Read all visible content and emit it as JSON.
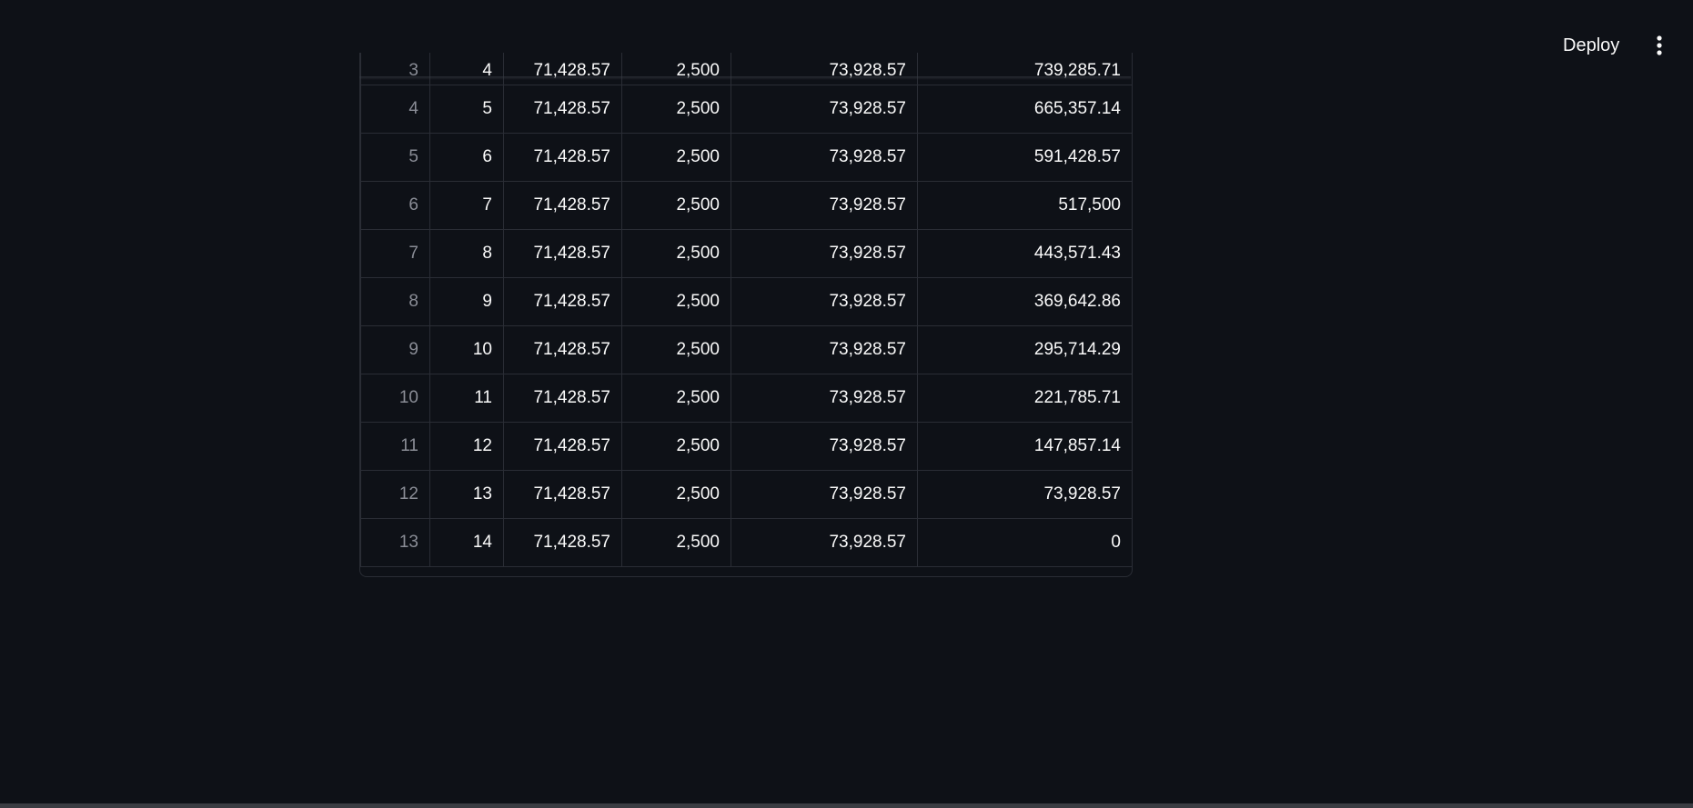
{
  "header": {
    "deploy_label": "Deploy",
    "menu_icon": "vertical-dots-icon"
  },
  "table": {
    "columns": [
      "",
      "",
      "",
      "",
      "",
      ""
    ],
    "partial_row": {
      "index": "3",
      "cells": [
        "4",
        "71,428.57",
        "2,500",
        "73,928.57",
        "739,285.71"
      ]
    },
    "rows": [
      {
        "index": "4",
        "cells": [
          "5",
          "71,428.57",
          "2,500",
          "73,928.57",
          "665,357.14"
        ]
      },
      {
        "index": "5",
        "cells": [
          "6",
          "71,428.57",
          "2,500",
          "73,928.57",
          "591,428.57"
        ]
      },
      {
        "index": "6",
        "cells": [
          "7",
          "71,428.57",
          "2,500",
          "73,928.57",
          "517,500"
        ]
      },
      {
        "index": "7",
        "cells": [
          "8",
          "71,428.57",
          "2,500",
          "73,928.57",
          "443,571.43"
        ]
      },
      {
        "index": "8",
        "cells": [
          "9",
          "71,428.57",
          "2,500",
          "73,928.57",
          "369,642.86"
        ]
      },
      {
        "index": "9",
        "cells": [
          "10",
          "71,428.57",
          "2,500",
          "73,928.57",
          "295,714.29"
        ]
      },
      {
        "index": "10",
        "cells": [
          "11",
          "71,428.57",
          "2,500",
          "73,928.57",
          "221,785.71"
        ]
      },
      {
        "index": "11",
        "cells": [
          "12",
          "71,428.57",
          "2,500",
          "73,928.57",
          "147,857.14"
        ]
      },
      {
        "index": "12",
        "cells": [
          "13",
          "71,428.57",
          "2,500",
          "73,928.57",
          "73,928.57"
        ]
      },
      {
        "index": "13",
        "cells": [
          "14",
          "71,428.57",
          "2,500",
          "73,928.57",
          "0"
        ]
      }
    ]
  }
}
